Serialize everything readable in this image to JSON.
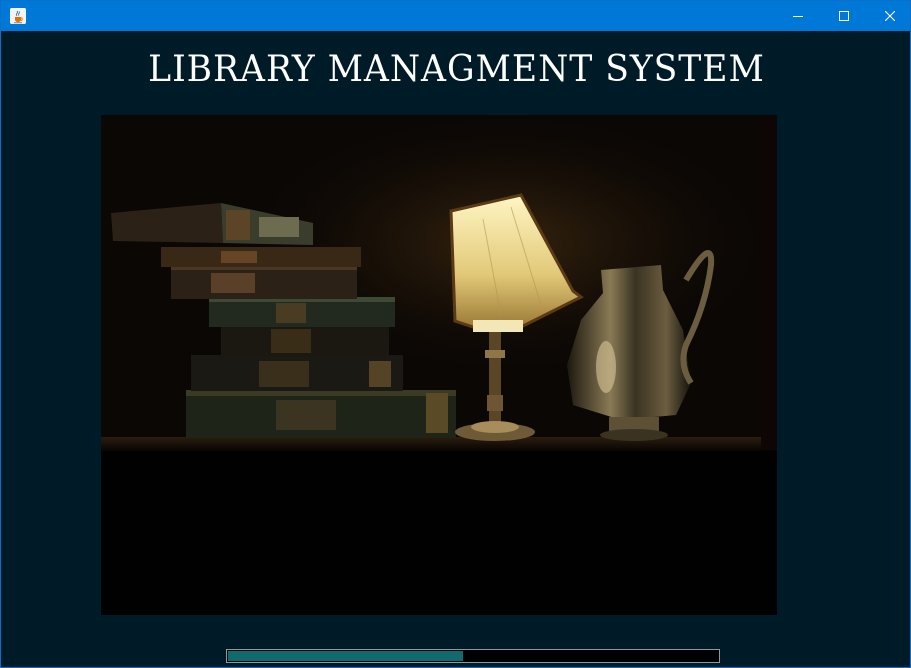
{
  "window": {
    "title": "",
    "controls": [
      "minimize",
      "maximize",
      "close"
    ]
  },
  "heading": "LIBRARY MANAGMENT SYSTEM",
  "splash_image": {
    "subject": "stacked-old-books-lamp-and-silver-pitcher"
  },
  "loading": {
    "progress": 0.48
  },
  "colors": {
    "titlebar": "#0078d7",
    "background": "#001b28",
    "progress_fill": "#0f6b6e",
    "heading_text": "#ffffff"
  }
}
